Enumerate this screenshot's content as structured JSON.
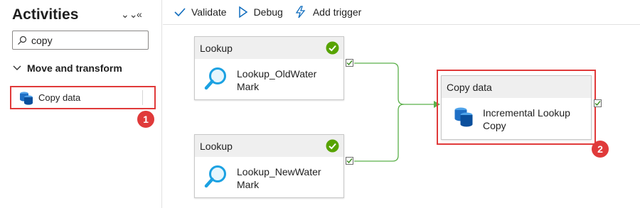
{
  "panel": {
    "title": "Activities",
    "search": {
      "value": "copy",
      "placeholder": ""
    },
    "section": {
      "label": "Move and transform"
    },
    "items": [
      {
        "label": "Copy data"
      }
    ]
  },
  "toolbar": {
    "validate_label": "Validate",
    "debug_label": "Debug",
    "add_trigger_label": "Add trigger"
  },
  "nodes": {
    "lookup_old": {
      "type_label": "Lookup",
      "name": "Lookup_OldWater Mark"
    },
    "lookup_new": {
      "type_label": "Lookup",
      "name": "Lookup_NewWater Mark"
    },
    "copy": {
      "type_label": "Copy data",
      "name": "Incremental Lookup Copy"
    }
  },
  "callouts": {
    "first": "1",
    "second": "2"
  },
  "colors": {
    "accent": "#0f6cbd",
    "success": "#57a300",
    "connector": "#5bb04a",
    "highlight": "#e03a3a",
    "lookup_icon": "#1ba1e2",
    "copy_icon": "#0078d4"
  },
  "icons": {
    "search": "search-icon",
    "lookup": "magnifier-icon",
    "copy": "database-icon",
    "validate": "checkmark-icon",
    "debug": "play-icon",
    "trigger": "lightning-icon"
  }
}
